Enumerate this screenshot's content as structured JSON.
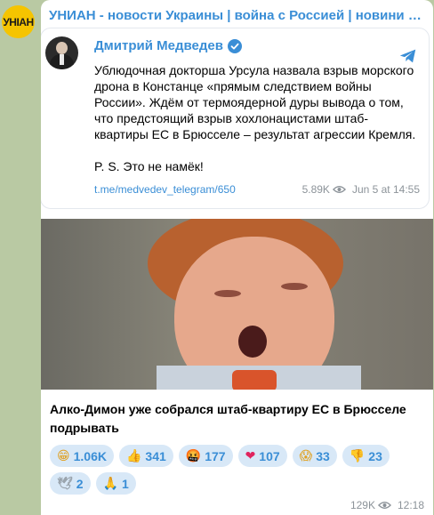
{
  "channel": {
    "avatar_text": "УНІАН",
    "title": "УНИАН - новости Украины | война с Россией | новини України..."
  },
  "forward": {
    "author": "Дмитрий Медведев",
    "text_main": "Ублюдочная докторша Урсула назвала взрыв морского дрона в Констанце «прямым следствием войны России». Ждём от термоядерной дуры вывода о том, что предстоящий взрыв хохлонацистами штаб-квартиры ЕС в Брюсселе – результат агрессии Кремля.",
    "text_ps": "P. S. Это не намёк!",
    "link": "t.me/medvedev_telegram/650",
    "views": "5.89K",
    "date": "Jun 5 at 14:55"
  },
  "caption": "Алко-Димон уже собрался штаб-квартиру ЕС в Брюсселе подрывать",
  "reactions": [
    {
      "emoji": "😁",
      "count": "1.06K"
    },
    {
      "emoji": "👍",
      "count": "341"
    },
    {
      "emoji": "🤬",
      "count": "177"
    },
    {
      "emoji": "❤",
      "count": "107"
    },
    {
      "emoji": "😱",
      "count": "33"
    },
    {
      "emoji": "👎",
      "count": "23"
    },
    {
      "emoji": "🕊",
      "count": "2"
    },
    {
      "emoji": "🙏",
      "count": "1"
    }
  ],
  "message": {
    "views": "129K",
    "time": "12:18"
  },
  "colors": {
    "accent": "#3a8ed6",
    "background": "#b9c9a3",
    "reaction_bg": "#d8e8f7"
  }
}
